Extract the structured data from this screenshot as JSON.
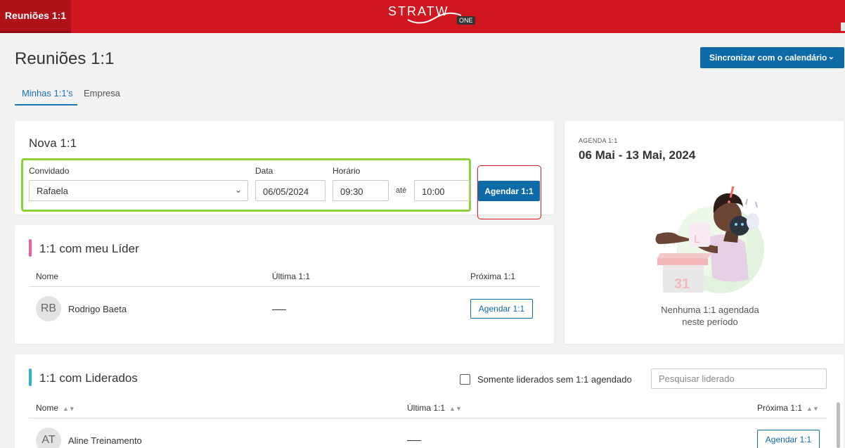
{
  "topbar": {
    "tab_label": "Reuniões 1:1",
    "logo_text": "STRATW",
    "logo_badge": "ONE"
  },
  "header": {
    "title": "Reuniões 1:1",
    "sync_button": "Sincronizar com o calendário"
  },
  "tabs": [
    {
      "label": "Minhas 1:1's",
      "active": true
    },
    {
      "label": "Empresa",
      "active": false
    }
  ],
  "new_meeting": {
    "title": "Nova 1:1",
    "guest_label": "Convidado",
    "guest_value": "Rafaela",
    "date_label": "Data",
    "date_value": "06/05/2024",
    "time_label": "Horário",
    "time_start": "09:30",
    "until_label": "até",
    "time_end": "10:00",
    "schedule_button": "Agendar 1:1"
  },
  "leader": {
    "title": "1:1 com meu Líder",
    "accent": "#e85fa8",
    "columns": [
      "Nome",
      "Última 1:1",
      "Próxima 1:1"
    ],
    "rows": [
      {
        "initials": "RB",
        "name": "Rodrigo Baeta",
        "button": "Agendar 1:1"
      }
    ]
  },
  "agenda": {
    "label": "AGENDA 1:1",
    "range": "06 Mai - 13 Mai, 2024",
    "illustration_number": "31",
    "empty_line1": "Nenhuma 1:1 agendada",
    "empty_line2": "neste período"
  },
  "led": {
    "title": "1:1 com Liderados",
    "accent": "#2bb2d6",
    "filter_label": "Somente liderados sem 1:1 agendado",
    "search_placeholder": "Pesquisar liderado",
    "columns": [
      "Nome",
      "Última 1:1",
      "Próxima 1:1"
    ],
    "rows": [
      {
        "initials": "AT",
        "name": "Aline Treinamento",
        "button": "Agendar 1:1"
      }
    ]
  },
  "colors": {
    "brand_red": "#d0161f",
    "primary_blue": "#0e6ba8",
    "highlight_green": "#8dd13a"
  },
  "icons": [
    "chevron-down-icon",
    "sort-icon",
    "checkbox-icon"
  ]
}
